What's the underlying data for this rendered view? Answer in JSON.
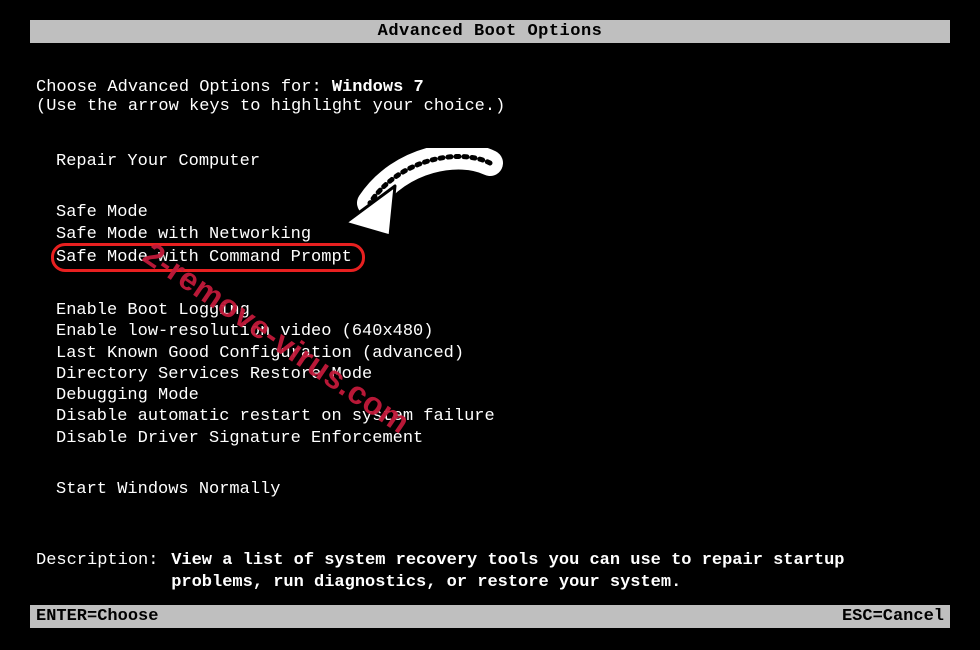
{
  "title": "Advanced Boot Options",
  "prompt_prefix": "Choose Advanced Options for: ",
  "os_name": "Windows 7",
  "hint": "(Use the arrow keys to highlight your choice.)",
  "groups": [
    {
      "items": [
        {
          "label": "Repair Your Computer",
          "highlighted": false
        }
      ]
    },
    {
      "items": [
        {
          "label": "Safe Mode",
          "highlighted": false
        },
        {
          "label": "Safe Mode with Networking",
          "highlighted": false
        },
        {
          "label": "Safe Mode with Command Prompt",
          "highlighted": true
        }
      ]
    },
    {
      "items": [
        {
          "label": "Enable Boot Logging",
          "highlighted": false
        },
        {
          "label": "Enable low-resolution video (640x480)",
          "highlighted": false
        },
        {
          "label": "Last Known Good Configuration (advanced)",
          "highlighted": false
        },
        {
          "label": "Directory Services Restore Mode",
          "highlighted": false
        },
        {
          "label": "Debugging Mode",
          "highlighted": false
        },
        {
          "label": "Disable automatic restart on system failure",
          "highlighted": false
        },
        {
          "label": "Disable Driver Signature Enforcement",
          "highlighted": false
        }
      ]
    },
    {
      "items": [
        {
          "label": "Start Windows Normally",
          "highlighted": false
        }
      ]
    }
  ],
  "description_label": "Description:",
  "description_text": "View a list of system recovery tools you can use to repair startup problems, run diagnostics, or restore your system.",
  "footer": {
    "left": "ENTER=Choose",
    "right": "ESC=Cancel"
  },
  "watermark": "2-remove-virus.com"
}
